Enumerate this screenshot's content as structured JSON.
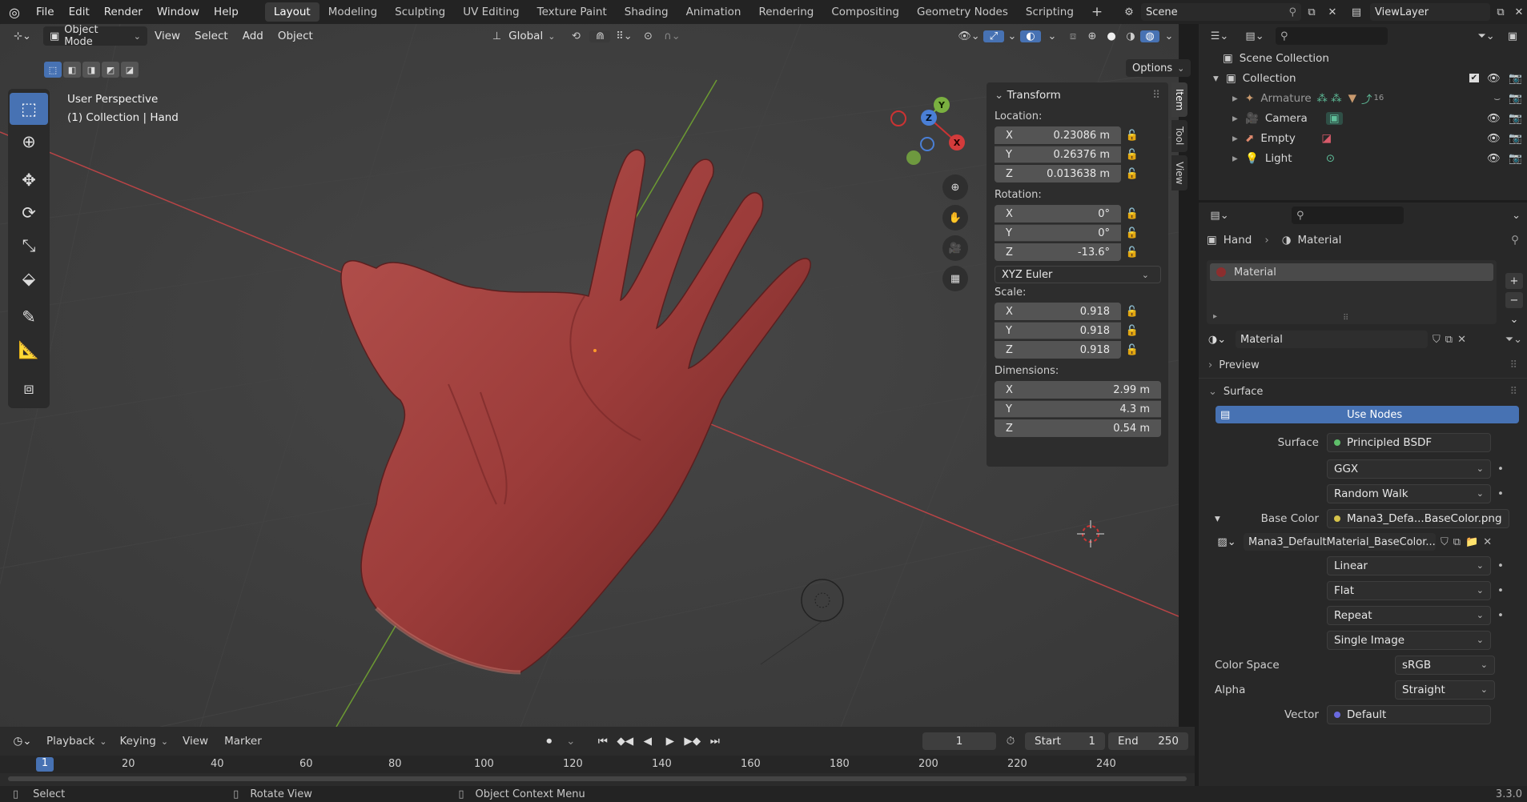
{
  "app": {
    "version": "3.3.0"
  },
  "topbar": {
    "menus": [
      "File",
      "Edit",
      "Render",
      "Window",
      "Help"
    ],
    "workspaces": [
      "Layout",
      "Modeling",
      "Sculpting",
      "UV Editing",
      "Texture Paint",
      "Shading",
      "Animation",
      "Rendering",
      "Compositing",
      "Geometry Nodes",
      "Scripting"
    ],
    "active_workspace": "Layout",
    "add_tab": "+",
    "scene": "Scene",
    "view_layer": "ViewLayer"
  },
  "viewport_header": {
    "mode": "Object Mode",
    "menus": [
      "View",
      "Select",
      "Add",
      "Object"
    ],
    "transform_orientation": "Global",
    "options": "Options"
  },
  "viewport": {
    "perspective": "User Perspective",
    "context": "(1) Collection | Hand",
    "gizmo": {
      "x": "X",
      "y": "Y",
      "z": "Z"
    }
  },
  "npanel": {
    "title": "Transform",
    "location_label": "Location:",
    "location": [
      {
        "axis": "X",
        "value": "0.23086 m"
      },
      {
        "axis": "Y",
        "value": "0.26376 m"
      },
      {
        "axis": "Z",
        "value": "0.013638 m"
      }
    ],
    "rotation_label": "Rotation:",
    "rotation": [
      {
        "axis": "X",
        "value": "0°"
      },
      {
        "axis": "Y",
        "value": "0°"
      },
      {
        "axis": "Z",
        "value": "-13.6°"
      }
    ],
    "rotation_mode": "XYZ Euler",
    "scale_label": "Scale:",
    "scale": [
      {
        "axis": "X",
        "value": "0.918"
      },
      {
        "axis": "Y",
        "value": "0.918"
      },
      {
        "axis": "Z",
        "value": "0.918"
      }
    ],
    "dimensions_label": "Dimensions:",
    "dimensions": [
      {
        "axis": "X",
        "value": "2.99 m"
      },
      {
        "axis": "Y",
        "value": "4.3 m"
      },
      {
        "axis": "Z",
        "value": "0.54 m"
      }
    ],
    "tabs": [
      "Item",
      "Tool",
      "View"
    ]
  },
  "outliner": {
    "scene_collection": "Scene Collection",
    "collection": "Collection",
    "items": [
      {
        "name": "Armature",
        "badge": "16",
        "color": "#c99a6e"
      },
      {
        "name": "Camera",
        "color": "#8fbcd4"
      },
      {
        "name": "Empty",
        "color": "#e08a6e"
      },
      {
        "name": "Light",
        "color": "#e0c46e"
      }
    ]
  },
  "properties": {
    "breadcrumb_object": "Hand",
    "breadcrumb_sep": "›",
    "breadcrumb_data": "Material",
    "slot": "Material",
    "material_name": "Material",
    "preview": "Preview",
    "surface_section": "Surface",
    "use_nodes": "Use Nodes",
    "rows": [
      {
        "label": "Surface",
        "value": "Principled BSDF",
        "dot": "#5fbf6a"
      },
      {
        "label": "",
        "value": "GGX"
      },
      {
        "label": "",
        "value": "Random Walk"
      },
      {
        "label": "Base Color",
        "value": "Mana3_Defa...BaseColor.png",
        "dot": "#d6c34a"
      }
    ],
    "image_name": "Mana3_DefaultMaterial_BaseColor...",
    "image_rows": [
      "Linear",
      "Flat",
      "Repeat",
      "Single Image"
    ],
    "color_space_label": "Color Space",
    "color_space": "sRGB",
    "alpha_label": "Alpha",
    "alpha": "Straight",
    "vector_label": "Vector",
    "vector": "Default"
  },
  "timeline": {
    "menus": [
      "Playback",
      "Keying",
      "View",
      "Marker"
    ],
    "current_frame": "1",
    "start_label": "Start",
    "start": "1",
    "end_label": "End",
    "end": "250",
    "ticks": [
      "1",
      "20",
      "40",
      "60",
      "80",
      "100",
      "120",
      "140",
      "160",
      "180",
      "200",
      "220",
      "240"
    ]
  },
  "statusbar": {
    "hints": [
      "Select",
      "Rotate View",
      "Object Context Menu"
    ]
  }
}
